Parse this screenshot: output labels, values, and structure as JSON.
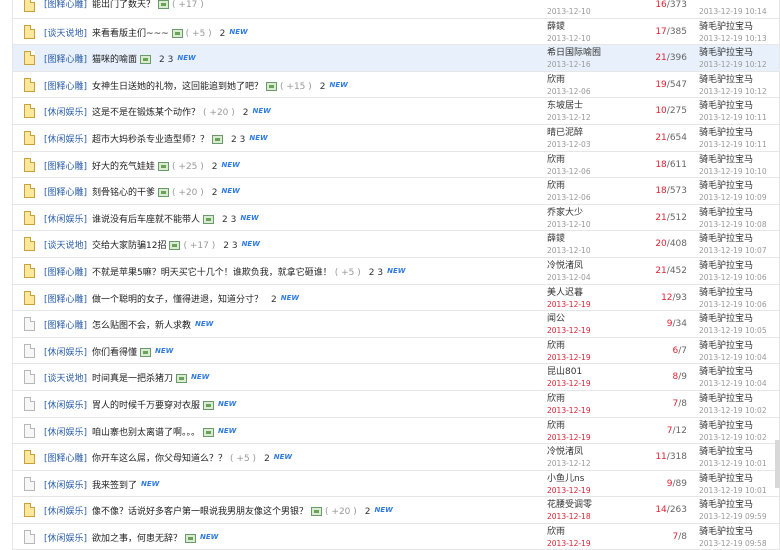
{
  "threads": [
    {
      "icon": "hot",
      "cat": "[图释心雕]",
      "title": "能出门了数天？",
      "img": true,
      "pages": "( +17 )",
      "page2": "",
      "isNew": false,
      "author": "",
      "date": "2013-12-10",
      "dateRed": false,
      "replies": "16",
      "views": "/373",
      "lastUser": "",
      "lastDate": "2013-12-19 10:14"
    },
    {
      "icon": "hot",
      "cat": "[谈天说地]",
      "title": "来看看版主们~~~",
      "img": true,
      "pages": "( +5 )",
      "page2": "2",
      "isNew": true,
      "author": "薛鑁",
      "date": "2013-12-10",
      "dateRed": false,
      "replies": "17",
      "views": "/385",
      "lastUser": "骑毛驴拉宝马",
      "lastDate": "2013-12-19 10:13"
    },
    {
      "icon": "hot",
      "cat": "[图释心雕]",
      "title": "猫咪的喻面",
      "img": true,
      "pages": "",
      "page2": "2 3",
      "isNew": true,
      "author": "希日国际喻囿",
      "date": "2013-12-16",
      "dateRed": false,
      "replies": "21",
      "views": "/396",
      "lastUser": "骑毛驴拉宝马",
      "lastDate": "2013-12-19 10:12",
      "hl": true
    },
    {
      "icon": "hot",
      "cat": "[图释心雕]",
      "title": "女神生日送她的礼物，这回能追到她了吧？",
      "img": true,
      "pages": "( +15 )",
      "page2": "2",
      "isNew": true,
      "author": "欣雨",
      "date": "2013-12-06",
      "dateRed": false,
      "replies": "19",
      "views": "/547",
      "lastUser": "骑毛驴拉宝马",
      "lastDate": "2013-12-19 10:12"
    },
    {
      "icon": "hot",
      "cat": "[休闲娱乐]",
      "title": "这是不是在锻炼某个动作？",
      "img": false,
      "pages": "( +20 )",
      "page2": "2",
      "isNew": true,
      "author": "东坡居士",
      "date": "2013-12-12",
      "dateRed": false,
      "replies": "10",
      "views": "/275",
      "lastUser": "骑毛驴拉宝马",
      "lastDate": "2013-12-19 10:11"
    },
    {
      "icon": "hot",
      "cat": "[休闲娱乐]",
      "title": "超市大妈秒杀专业造型师？？",
      "img": true,
      "pages": "",
      "page2": "2 3",
      "isNew": true,
      "author": "晴已泥醉",
      "date": "2013-12-03",
      "dateRed": false,
      "replies": "21",
      "views": "/654",
      "lastUser": "骑毛驴拉宝马",
      "lastDate": "2013-12-19 10:11"
    },
    {
      "icon": "hot",
      "cat": "[图释心雕]",
      "title": "好大的充气娃娃",
      "img": true,
      "pages": "( +25 )",
      "page2": "2",
      "isNew": true,
      "author": "欣雨",
      "date": "2013-12-06",
      "dateRed": false,
      "replies": "18",
      "views": "/611",
      "lastUser": "骑毛驴拉宝马",
      "lastDate": "2013-12-19 10:10"
    },
    {
      "icon": "hot",
      "cat": "[图释心雕]",
      "title": "刻骨铭心的干爹",
      "img": true,
      "pages": "( +20 )",
      "page2": "2",
      "isNew": true,
      "author": "欣雨",
      "date": "2013-12-06",
      "dateRed": false,
      "replies": "18",
      "views": "/573",
      "lastUser": "骑毛驴拉宝马",
      "lastDate": "2013-12-19 10:09"
    },
    {
      "icon": "hot",
      "cat": "[休闲娱乐]",
      "title": "谁说没有后车座就不能带人",
      "img": true,
      "pages": "",
      "page2": "2 3",
      "isNew": true,
      "author": "乔家大少",
      "date": "2013-12-10",
      "dateRed": false,
      "replies": "21",
      "views": "/512",
      "lastUser": "骑毛驴拉宝马",
      "lastDate": "2013-12-19 10:08"
    },
    {
      "icon": "hot",
      "cat": "[谈天说地]",
      "title": "交给大家防骗12招",
      "img": true,
      "pages": "( +17 )",
      "page2": "2 3",
      "isNew": true,
      "author": "薛鑁",
      "date": "2013-12-10",
      "dateRed": false,
      "replies": "20",
      "views": "/408",
      "lastUser": "骑毛驴拉宝马",
      "lastDate": "2013-12-19 10:07"
    },
    {
      "icon": "hot",
      "cat": "[图释心雕]",
      "title": "不就是苹果5嘛？明天买它十几个！谁欺负我，就拿它砸谁！",
      "img": false,
      "pages": "( +5 )",
      "page2": "2 3",
      "isNew": true,
      "author": "冷悦渚凤",
      "date": "2013-12-04",
      "dateRed": false,
      "replies": "21",
      "views": "/452",
      "lastUser": "骑毛驴拉宝马",
      "lastDate": "2013-12-19 10:06"
    },
    {
      "icon": "hot",
      "cat": "[图释心雕]",
      "title": "做一个聪明的女子，懂得进退，知道分寸？",
      "img": false,
      "pages": "",
      "page2": "2",
      "isNew": true,
      "author": "美人迟暮",
      "date": "2013-12-19",
      "dateRed": true,
      "replies": "12",
      "views": "/93",
      "lastUser": "骑毛驴拉宝马",
      "lastDate": "2013-12-19 10:06"
    },
    {
      "icon": "plain",
      "cat": "[图释心雕]",
      "title": "怎么贴图不会，新人求教",
      "img": false,
      "pages": "",
      "page2": "",
      "isNew": true,
      "author": "闻公",
      "date": "2013-12-19",
      "dateRed": true,
      "replies": "9",
      "views": "/34",
      "lastUser": "骑毛驴拉宝马",
      "lastDate": "2013-12-19 10:05"
    },
    {
      "icon": "plain",
      "cat": "[休闲娱乐]",
      "title": "你们看得懂",
      "img": true,
      "pages": "",
      "page2": "",
      "isNew": true,
      "author": "欣雨",
      "date": "2013-12-19",
      "dateRed": true,
      "replies": "6",
      "views": "/7",
      "lastUser": "骑毛驴拉宝马",
      "lastDate": "2013-12-19 10:04"
    },
    {
      "icon": "plain",
      "cat": "[谈天说地]",
      "title": "时间真是一把杀猪刀",
      "img": true,
      "pages": "",
      "page2": "",
      "isNew": true,
      "author": "昆山801",
      "date": "2013-12-19",
      "dateRed": true,
      "replies": "8",
      "views": "/9",
      "lastUser": "骑毛驴拉宝马",
      "lastDate": "2013-12-19 10:04"
    },
    {
      "icon": "plain",
      "cat": "[休闲娱乐]",
      "title": "胃人的时候千万要穿对衣服",
      "img": true,
      "pages": "",
      "page2": "",
      "isNew": true,
      "author": "欣雨",
      "date": "2013-12-19",
      "dateRed": true,
      "replies": "7",
      "views": "/8",
      "lastUser": "骑毛驴拉宝马",
      "lastDate": "2013-12-19 10:02"
    },
    {
      "icon": "plain",
      "cat": "[休闲娱乐]",
      "title": "咱山寨也别太离谱了啊。。。",
      "img": true,
      "pages": "",
      "page2": "",
      "isNew": true,
      "author": "欣雨",
      "date": "2013-12-19",
      "dateRed": true,
      "replies": "7",
      "views": "/12",
      "lastUser": "骑毛驴拉宝马",
      "lastDate": "2013-12-19 10:02"
    },
    {
      "icon": "hot",
      "cat": "[图释心雕]",
      "title": "你开车这么屌，你父母知道么？？",
      "img": false,
      "pages": "( +5 )",
      "page2": "2",
      "isNew": true,
      "author": "冷悦渚凤",
      "date": "2013-12-12",
      "dateRed": false,
      "replies": "11",
      "views": "/318",
      "lastUser": "骑毛驴拉宝马",
      "lastDate": "2013-12-19 10:01"
    },
    {
      "icon": "plain",
      "cat": "[休闲娱乐]",
      "title": "我来签到了",
      "img": false,
      "pages": "",
      "page2": "",
      "isNew": true,
      "author": "小鱼儿ns",
      "date": "2013-12-19",
      "dateRed": true,
      "replies": "9",
      "views": "/89",
      "lastUser": "骑毛驴拉宝马",
      "lastDate": "2013-12-19 10:01"
    },
    {
      "icon": "hot",
      "cat": "[休闲娱乐]",
      "title": "像不像？话说好多客户第一眼说我男朋友像这个男银？",
      "img": true,
      "pages": "( +20 )",
      "page2": "2",
      "isNew": true,
      "author": "花腰受调零",
      "date": "2013-12-18",
      "dateRed": true,
      "replies": "14",
      "views": "/263",
      "lastUser": "骑毛驴拉宝马",
      "lastDate": "2013-12-19 09:59"
    },
    {
      "icon": "plain",
      "cat": "[休闲娱乐]",
      "title": "欲加之事，何患无辞？",
      "img": true,
      "pages": "",
      "page2": "",
      "isNew": true,
      "author": "欣雨",
      "date": "2013-12-19",
      "dateRed": true,
      "replies": "7",
      "views": "/8",
      "lastUser": "骑毛驴拉宝马",
      "lastDate": "2013-12-19 09:58"
    }
  ],
  "labels": {
    "new": "NEW"
  }
}
